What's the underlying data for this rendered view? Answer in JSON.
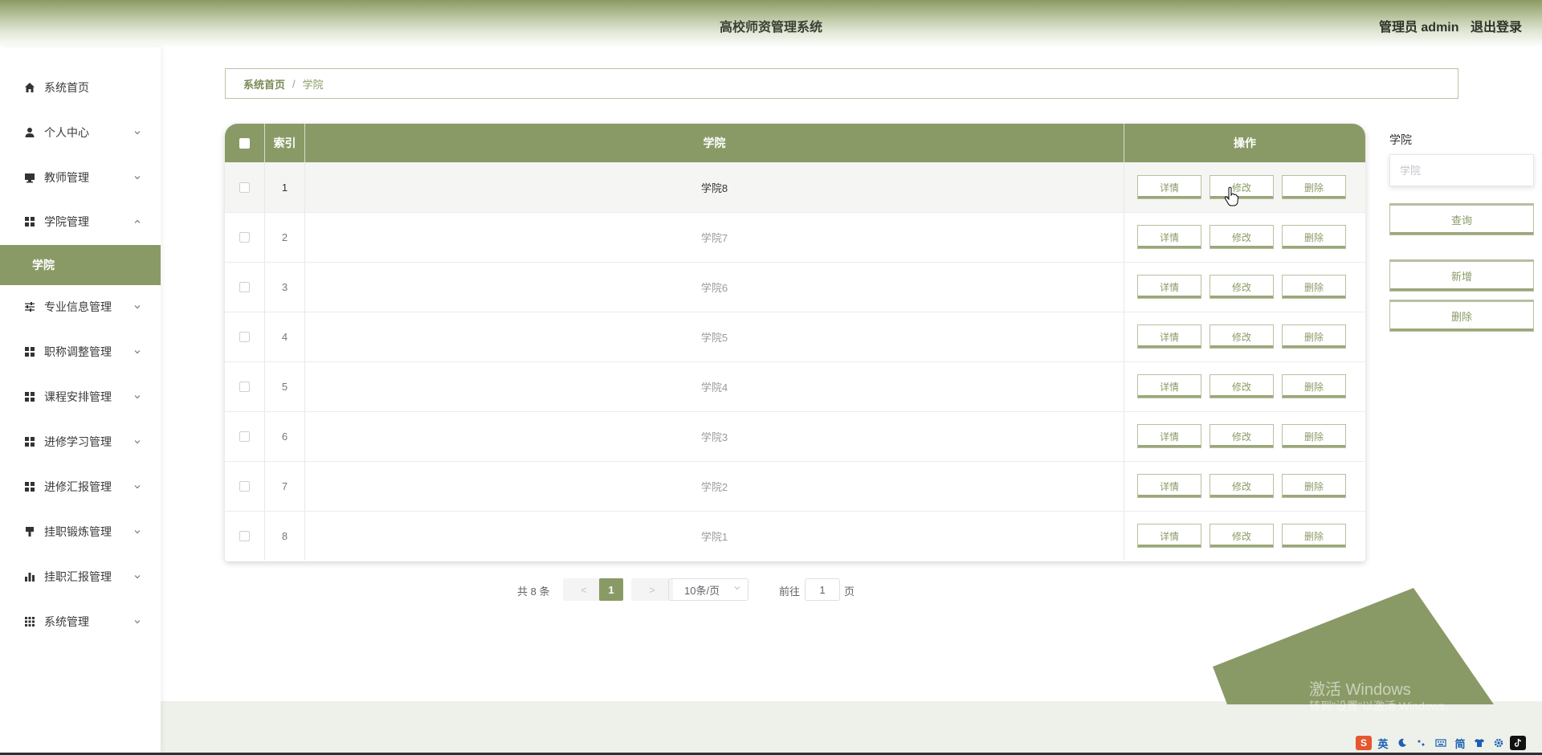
{
  "header": {
    "title": "高校师资管理系统",
    "user_label": "管理员 admin",
    "logout_label": "退出登录"
  },
  "sidebar": {
    "items": [
      {
        "label": "系统首页",
        "icon": "home-icon",
        "expandable": false
      },
      {
        "label": "个人中心",
        "icon": "user-icon",
        "expandable": true
      },
      {
        "label": "教师管理",
        "icon": "monitor-icon",
        "expandable": true
      },
      {
        "label": "学院管理",
        "icon": "grid-icon",
        "expandable": true,
        "expanded": true
      },
      {
        "label": "学院",
        "icon": "",
        "sub": true,
        "active": true
      },
      {
        "label": "专业信息管理",
        "icon": "sliders-icon",
        "expandable": true
      },
      {
        "label": "职称调整管理",
        "icon": "grid-icon",
        "expandable": true
      },
      {
        "label": "课程安排管理",
        "icon": "grid-icon",
        "expandable": true
      },
      {
        "label": "进修学习管理",
        "icon": "grid-icon",
        "expandable": true
      },
      {
        "label": "进修汇报管理",
        "icon": "grid-icon",
        "expandable": true
      },
      {
        "label": "挂职锻炼管理",
        "icon": "brush-icon",
        "expandable": true
      },
      {
        "label": "挂职汇报管理",
        "icon": "bar-chart-icon",
        "expandable": true
      },
      {
        "label": "系统管理",
        "icon": "apps-icon",
        "expandable": true
      }
    ]
  },
  "breadcrumb": {
    "home": "系统首页",
    "separator": "/",
    "current": "学院"
  },
  "table": {
    "headers": {
      "index": "索引",
      "name": "学院",
      "ops": "操作"
    },
    "op_labels": {
      "detail": "详情",
      "edit": "修改",
      "delete": "删除"
    },
    "rows": [
      {
        "index": "1",
        "name": "学院8"
      },
      {
        "index": "2",
        "name": "学院7"
      },
      {
        "index": "3",
        "name": "学院6"
      },
      {
        "index": "4",
        "name": "学院5"
      },
      {
        "index": "5",
        "name": "学院4"
      },
      {
        "index": "6",
        "name": "学院3"
      },
      {
        "index": "7",
        "name": "学院2"
      },
      {
        "index": "8",
        "name": "学院1"
      }
    ]
  },
  "pager": {
    "total": "共 8 条",
    "prev": "<",
    "current": "1",
    "next": ">",
    "page_size": "10条/页",
    "goto_label": "前往",
    "goto_value": "1",
    "page_unit": "页"
  },
  "search": {
    "label": "学院",
    "placeholder": "学院",
    "query_button": "查询",
    "add_button": "新增",
    "delete_button": "删除"
  },
  "watermark": {
    "line1": "激活 Windows",
    "line2": "转到\"设置\"以激活 Windows。"
  },
  "tray": {
    "items": [
      "英",
      "简"
    ]
  },
  "colors": {
    "accent": "#8a9a66",
    "header_top": "#8a9a66",
    "button_text": "#8a9a66"
  }
}
